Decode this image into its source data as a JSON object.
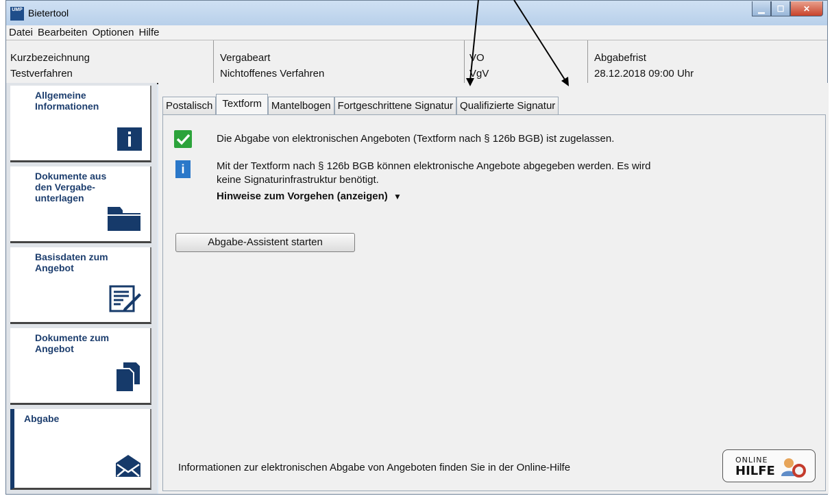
{
  "window": {
    "title": "Bietertool",
    "icon_label": "UMP"
  },
  "menu": [
    "Datei",
    "Bearbeiten",
    "Optionen",
    "Hilfe"
  ],
  "info": {
    "kurz_label": "Kurzbezeichnung",
    "kurz_value": "Testverfahren",
    "vergabe_label": "Vergabeart",
    "vergabe_value": "Nichtoffenes Verfahren",
    "vo_label": "VO",
    "vo_value": "VgV",
    "frist_label": "Abgabefrist",
    "frist_value": "28.12.2018 09:00 Uhr"
  },
  "sidebar": [
    {
      "label": "Allgemeine Informationen",
      "icon": "info-icon"
    },
    {
      "label": "Dokumente aus den Vergabe-unterlagen",
      "icon": "folder-icon"
    },
    {
      "label": "Basisdaten zum Angebot",
      "icon": "edit-form-icon"
    },
    {
      "label": "Dokumente zum Angebot",
      "icon": "documents-icon"
    },
    {
      "label": "Abgabe",
      "icon": "envelope-icon",
      "active": true
    }
  ],
  "tabs": [
    "Postalisch",
    "Textform",
    "Mantelbogen",
    "Fortgeschrittene Signatur",
    "Qualifizierte Signatur"
  ],
  "active_tab": "Textform",
  "panel": {
    "allowed_text": "Die Abgabe von elektronischen Angeboten (Textform nach § 126b BGB) ist zugelassen.",
    "info_line1": "Mit der Textform nach § 126b BGB können elektronische Angebote abgegeben werden. Es wird",
    "info_line2": "keine Signaturinfrastruktur benötigt.",
    "hint_toggle": "Hinweise zum Vorgehen (anzeigen)",
    "assistant_button": "Abgabe-Assistent starten",
    "footer_text": "Informationen zur elektronischen Abgabe von Angeboten finden Sie in der Online-Hilfe",
    "help_line1": "ONLINE",
    "help_line2": "HILFE"
  },
  "colors": {
    "accent": "#1d3e6e",
    "check": "#2ca33b",
    "info": "#2b78c9"
  }
}
